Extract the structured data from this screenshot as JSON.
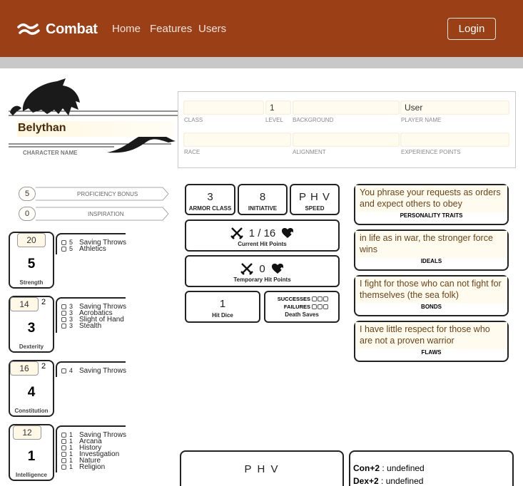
{
  "nav": {
    "brand": "Combat",
    "links": [
      "Home",
      "Features",
      "Users"
    ],
    "login": "Login"
  },
  "header": {
    "character_name": "Belythan",
    "character_name_label": "CHARACTER NAME",
    "class_label": "CLASS",
    "level": "1",
    "level_label": "LEVEL",
    "background_label": "BACKGROUND",
    "player_name": "User",
    "player_name_label": "PLAYER NAME",
    "race_label": "RACE",
    "alignment_label": "ALIGNMENT",
    "xp_label": "EXPERIENCE POINTS"
  },
  "proficiency": {
    "value": "5",
    "label": "PROFICIENCY BONUS"
  },
  "inspiration": {
    "value": "0",
    "label": "INSPIRATION"
  },
  "abilities": [
    {
      "name": "Strength",
      "score": "20",
      "mod": "5",
      "badge": "",
      "skills": [
        [
          "5",
          "Saving Throws"
        ],
        [
          "5",
          "Athletics"
        ]
      ]
    },
    {
      "name": "Dexterity",
      "score": "14",
      "mod": "3",
      "badge": "2",
      "skills": [
        [
          "3",
          "Saving Throws"
        ],
        [
          "3",
          "Acrobatics"
        ],
        [
          "3",
          "Slight of Hand"
        ],
        [
          "3",
          "Stealth"
        ]
      ]
    },
    {
      "name": "Constitution",
      "score": "16",
      "mod": "4",
      "badge": "2",
      "skills": [
        [
          "4",
          "Saving Throws"
        ]
      ]
    },
    {
      "name": "Intelligence",
      "score": "12",
      "mod": "1",
      "badge": "",
      "skills": [
        [
          "1",
          "Saving Throws"
        ],
        [
          "1",
          "Arcana"
        ],
        [
          "1",
          "History"
        ],
        [
          "1",
          "Investigation"
        ],
        [
          "1",
          "Nature"
        ],
        [
          "1",
          "Religion"
        ]
      ]
    }
  ],
  "combat": {
    "armor_class": "3",
    "armor_class_label": "ARMOR CLASS",
    "initiative": "8",
    "initiative_label": "INITIATIVE",
    "speed": "P H V",
    "speed_label": "SPEED",
    "current_hp": "1 / 16",
    "current_hp_label": "Current Hit Points",
    "temp_hp": "0",
    "temp_hp_label": "Temporary Hit Points",
    "hit_dice": "1",
    "hit_dice_label": "Hit Dice",
    "successes_label": "SUCCESSES",
    "failures_label": "FAILURES",
    "death_saves_label": "Death Saves"
  },
  "traits": [
    {
      "text": "You phrase your requests as orders and expect others to obey",
      "label": "PERSONALITY TRAITS"
    },
    {
      "text": "in life as in war, the stronger force wins",
      "label": "IDEALS"
    },
    {
      "text": "I fight for those who can not fight for themselves (the sea folk)",
      "label": "BONDS"
    },
    {
      "text": "I have little respect for those who are not a proven warrior",
      "label": "FLAWS"
    }
  ],
  "bottom": {
    "phv": "P H V",
    "features": [
      [
        "Con+2",
        " : undefined"
      ],
      [
        "Dex+2",
        " : undefined"
      ]
    ]
  },
  "colors": {
    "navbar": "#9b3f17",
    "accent_text": "#6b4416"
  }
}
